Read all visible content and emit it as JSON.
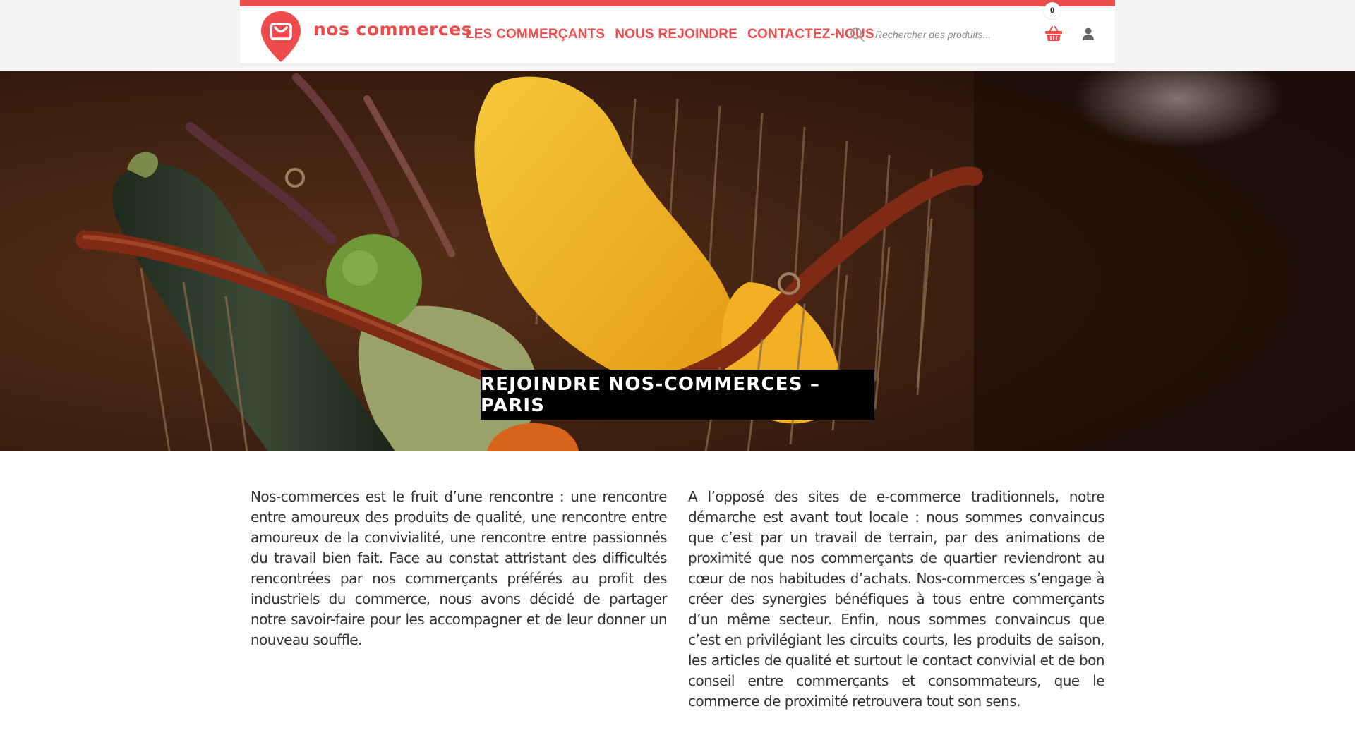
{
  "brand": {
    "name": "nos commerces",
    "accent_color": "#ee4c4c",
    "logo_icon": "map-pin-shopping-bag-icon"
  },
  "nav": {
    "items": [
      {
        "label": "LES COMMERÇANTS"
      },
      {
        "label": "NOUS REJOINDRE"
      },
      {
        "label": "CONTACTEZ-NOUS"
      }
    ]
  },
  "search": {
    "icon": "search-icon",
    "placeholder": "Rechercher des produits..."
  },
  "cart": {
    "icon": "shopping-basket-icon",
    "count": "0"
  },
  "account": {
    "icon": "user-icon"
  },
  "hero": {
    "image": "basket-of-vegetables-photo",
    "title": "REJOINDRE NOS-COMMERCES – PARIS"
  },
  "content": {
    "left_paragraph": "Nos-commerces est le fruit d’une rencontre : une rencontre entre amoureux des produits de qualité, une rencontre entre amoureux de la convivialité, une rencontre entre passionnés du travail bien fait. Face au constat attristant des difficultés rencontrées par nos commerçants préférés au profit des industriels du commerce, nous avons décidé de partager notre savoir-faire pour les accompagner et de leur donner un nouveau souffle.",
    "right_paragraph": "A l’opposé des sites de e-commerce traditionnels, notre démarche est avant tout locale : nous sommes convaincus que c’est par un travail de terrain, par des animations de proximité que nos commerçants de quartier reviendront au cœur de nos habitudes d’achats. Nos-commerces s’engage à créer des synergies bénéfiques à tous entre commerçants d’un même secteur. Enfin, nous sommes convaincus que c’est en privilégiant les circuits courts, les produits de saison, les articles de qualité et surtout le contact convivial et de bon conseil entre commerçants et consommateurs, que le commerce de proximité retrouvera tout son sens."
  }
}
